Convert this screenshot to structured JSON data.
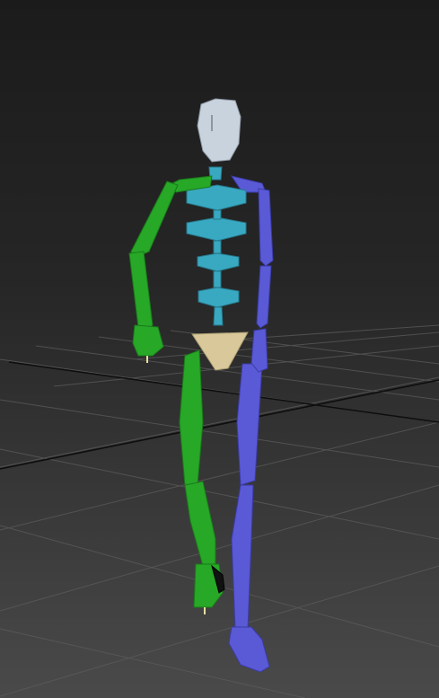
{
  "viewport": {
    "background_top": "#1b1b1b",
    "background_bottom": "#4a4a4a",
    "grid_color": "#5a5a5a",
    "grid_axis_color": "#111111"
  },
  "skeleton": {
    "head_color": "#c9d3de",
    "spine_color": "#39a9c2",
    "pelvis_color": "#d9c99a",
    "left_limbs_color": "#27a827",
    "right_limbs_color": "#5a5ad6"
  }
}
